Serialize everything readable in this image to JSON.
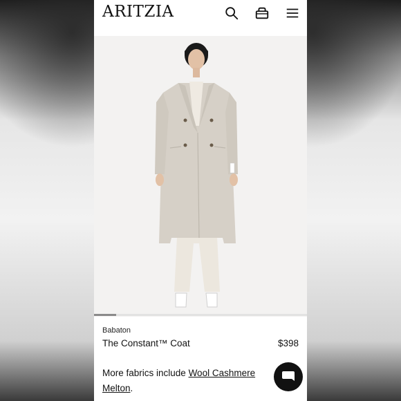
{
  "header": {
    "logo": "ARITZIA",
    "icons": [
      "search-icon",
      "bag-icon",
      "hamburger-menu-icon"
    ]
  },
  "carousel": {
    "position": 1,
    "progress_fraction": 0.1
  },
  "product": {
    "brand": "Babaton",
    "name": "The Constant™ Coat",
    "price": "$398"
  },
  "fabrics": {
    "prefix": "More fabrics include ",
    "link1": "Wool Cashmere",
    "link2": "Melton",
    "suffix": "."
  },
  "chat": {
    "icon": "chat-bubble-icon"
  },
  "colors": {
    "coat": "#d6d0c7",
    "trousers": "#ece7de",
    "accent": "#111111"
  }
}
